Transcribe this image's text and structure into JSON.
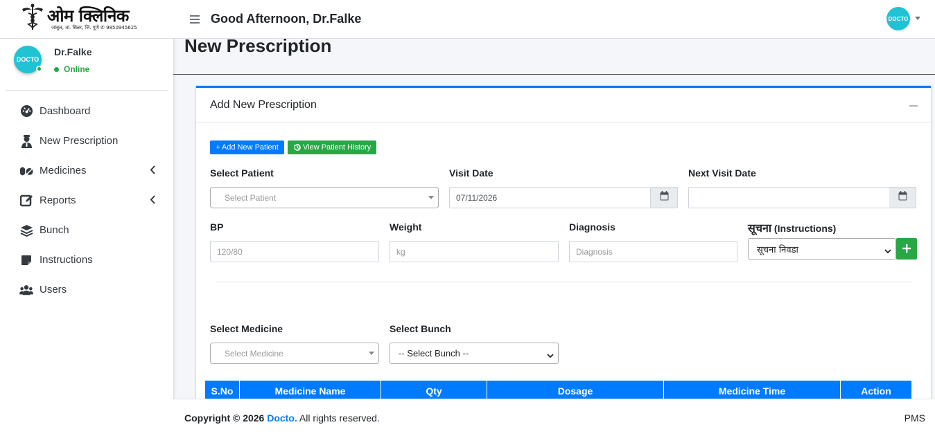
{
  "brand": {
    "title": "ओम क्लिनिक",
    "subtitle": "जांबुल, ता. सिन्नर, जि. पुणे ✆ 9850945625"
  },
  "user": {
    "name": "Dr.Falke",
    "status": "Online",
    "avatar_text": "DOCTO"
  },
  "sidebar": {
    "items": [
      {
        "label": "Dashboard",
        "icon": "tachometer-icon"
      },
      {
        "label": "New Prescription",
        "icon": "user-doctor-icon"
      },
      {
        "label": "Medicines",
        "icon": "pills-icon",
        "has_submenu": true
      },
      {
        "label": "Reports",
        "icon": "edit-icon",
        "has_submenu": true
      },
      {
        "label": "Bunch",
        "icon": "layer-group-icon"
      },
      {
        "label": "Instructions",
        "icon": "sticky-note-icon"
      },
      {
        "label": "Users",
        "icon": "users-icon"
      }
    ]
  },
  "topbar": {
    "greeting": "Good Afternoon, Dr.Falke",
    "avatar_text": "DOCTO"
  },
  "page": {
    "title": "New Prescription"
  },
  "card": {
    "title": "Add New Prescription",
    "add_patient_label": "+ Add New Patient",
    "view_history_label": "View Patient History"
  },
  "form": {
    "select_patient": {
      "label": "Select Patient",
      "placeholder": "Select Patient"
    },
    "visit_date": {
      "label": "Visit Date",
      "value": "07/11/2026"
    },
    "next_visit_date": {
      "label": "Next Visit Date",
      "value": ""
    },
    "bp": {
      "label": "BP",
      "placeholder": "120/80"
    },
    "weight": {
      "label": "Weight",
      "placeholder": "kg"
    },
    "diagnosis": {
      "label": "Diagnosis",
      "placeholder": "Diagnosis"
    },
    "instructions": {
      "label_hi": "सूचना",
      "label_en": "(Instructions)",
      "selected": "सूचना निवडा"
    },
    "select_medicine": {
      "label": "Select Medicine",
      "placeholder": "Select Medicine"
    },
    "select_bunch": {
      "label": "Select Bunch",
      "selected": "-- Select Bunch --"
    }
  },
  "table": {
    "headers": [
      "S.No",
      "Medicine Name",
      "Qty",
      "Dosage",
      "Medicine Time",
      "Action"
    ]
  },
  "footer": {
    "copyright": "Copyright © 2026",
    "brand": "Docto.",
    "rights": "All rights reserved.",
    "right_text": "PMS"
  },
  "colors": {
    "primary": "#007bff",
    "success": "#28a745",
    "avatar": "#1fc3d4"
  }
}
